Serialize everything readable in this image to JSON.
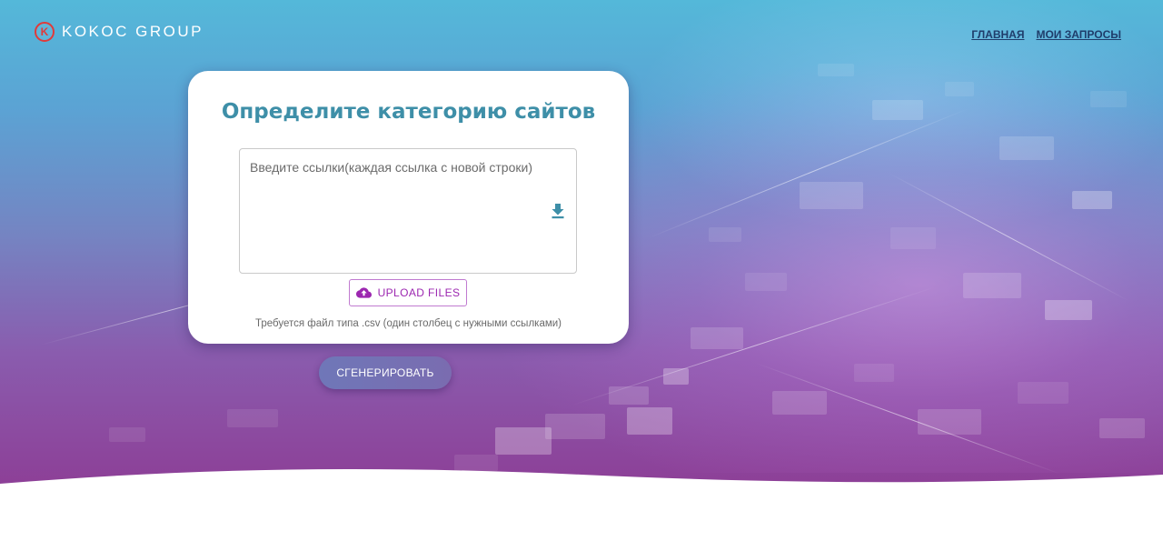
{
  "header": {
    "logo_mark": "K",
    "logo_text": "KOKOC GROUP",
    "nav": [
      {
        "label": "ГЛАВНАЯ"
      },
      {
        "label": "МОИ ЗАПРОСЫ"
      }
    ]
  },
  "card": {
    "title": "Определите категорию сайтов",
    "links_input": {
      "value": "",
      "placeholder": "Введите ссылки(каждая ссылка с новой строки)"
    },
    "download_icon": "download-icon",
    "upload_button": {
      "icon": "cloud-upload-icon",
      "label": "UPLOAD FILES"
    },
    "hint": "Требуется файл типа .csv (один столбец с нужными ссылками)"
  },
  "generate_button": {
    "label": "СГЕНЕРИРОВАТЬ"
  },
  "colors": {
    "title": "#3e8fa8",
    "upload_accent": "#9c27b0",
    "logo_red": "#e03a3a",
    "nav_link": "#1f3d6b"
  }
}
